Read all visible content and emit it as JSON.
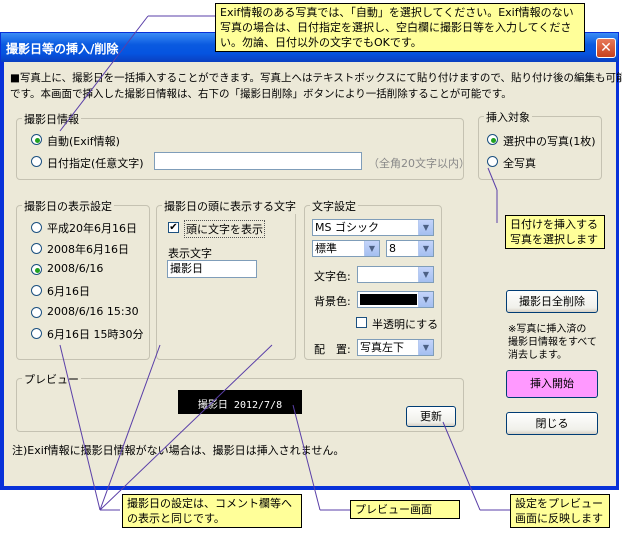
{
  "window": {
    "title": "撮影日等の挿入/削除",
    "close_glyph": "✕"
  },
  "description": {
    "line1": "■写真上に、撮影日を一括挿入することができます。写真上へはテキストボックスにて貼り付けますので、貼り付け後の編集も可能",
    "line2": "です。本画面で挿入した撮影日情報は、右下の「撮影日削除」ボタンにより一括削除することが可能です。"
  },
  "shooting_info": {
    "label": "撮影日情報",
    "auto_label": "自動(Exif情報)",
    "manual_label": "日付指定(任意文字)",
    "manual_value": "",
    "hint": "（全角20文字以内）"
  },
  "target": {
    "label": "挿入対象",
    "selected_label": "選択中の写真(1枚)",
    "all_label": "全写真"
  },
  "date_format": {
    "label": "撮影日の表示設定",
    "options": [
      "平成20年6月16日",
      "2008年6月16日",
      "2008/6/16",
      "6月16日",
      "2008/6/16  15:30",
      "6月16日  15時30分"
    ],
    "selected": "2008/6/16"
  },
  "prefix": {
    "label": "撮影日の頭に表示する文字",
    "checkbox_label": "頭に文字を表示",
    "display_label": "表示文字",
    "display_value": "撮影日"
  },
  "text_settings": {
    "label": "文字設定",
    "font": "MS ゴシック",
    "style": "標準",
    "size": "8",
    "text_color_label": "文字色:",
    "bg_color_label": "背景色:",
    "semi_transparent_label": "半透明にする",
    "position_label": "配　置:",
    "position_value": "写真左下",
    "bg_color": "#000000"
  },
  "preview": {
    "label": "プレビュー",
    "sample": "撮影日 2012/7/8",
    "update_button": "更新"
  },
  "note": "注)Exif情報に撮影日情報がない場合は、撮影日は挿入されません。",
  "side": {
    "delete_button": "撮影日全削除",
    "delete_note_1": "※写真に挿入済の",
    "delete_note_2": "撮影日情報をすべて",
    "delete_note_3": "消去します。",
    "start_button": "挿入開始",
    "close_button": "閉じる"
  },
  "callouts": {
    "top": "Exif情報のある写真では、「自動」を選択してください。Exif情報のない写真の場合は、日付指定を選択し、空白欄に撮影日等を入力してください。勿論、日付以外の文字でもOKです。",
    "target": "日付けを挿入する写真を選択します",
    "comment": "撮影日の設定は、コメント欄等への表示と同じです。",
    "preview": "プレビュー画面",
    "reflect": "設定をプレビュー画面に反映します"
  },
  "colors": {
    "callout_bg": "#ffff99",
    "start_button_bg": "#ff99ff",
    "titlebar": "#0a5ae0",
    "dialog_bg": "#ece9d8"
  }
}
